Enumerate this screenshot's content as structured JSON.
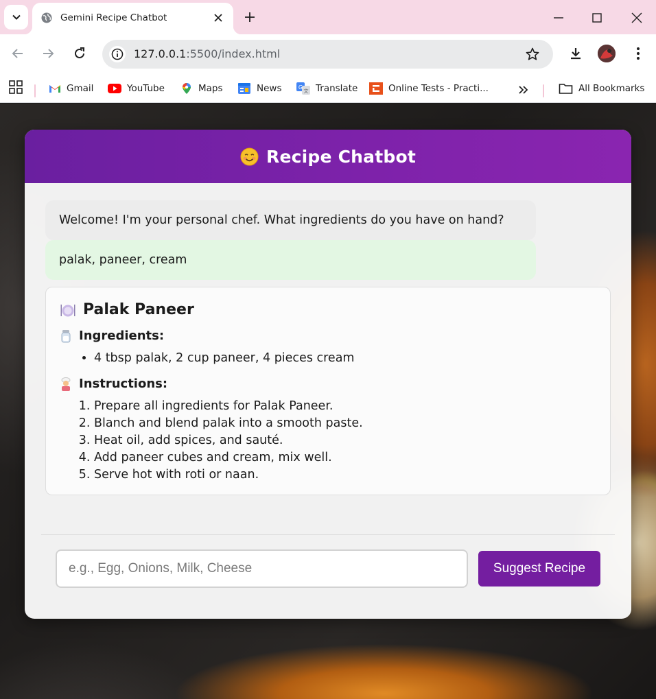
{
  "browser": {
    "tab_title": "Gemini Recipe Chatbot",
    "url_host": "127.0.0.1",
    "url_path": ":5500/index.html",
    "bookmarks": [
      {
        "label": "Gmail",
        "icon": "gmail-icon"
      },
      {
        "label": "YouTube",
        "icon": "youtube-icon"
      },
      {
        "label": "Maps",
        "icon": "maps-icon"
      },
      {
        "label": "News",
        "icon": "news-icon"
      },
      {
        "label": "Translate",
        "icon": "translate-icon"
      },
      {
        "label": "Online Tests - Practi...",
        "icon": "online-tests-icon"
      }
    ],
    "all_bookmarks": "All Bookmarks"
  },
  "app": {
    "title": "Recipe Chatbot",
    "title_emoji": "smiling-face-icon",
    "brand_color": "#7b21a8"
  },
  "chat": {
    "bot_message": "Welcome! I'm your personal chef. What ingredients do you have on hand?",
    "user_message": "palak, paneer, cream"
  },
  "recipe": {
    "name": "Palak Paneer",
    "ingredients_heading": "Ingredients:",
    "ingredients": [
      "4 tbsp palak, 2 cup paneer, 4 pieces cream"
    ],
    "instructions_heading": "Instructions:",
    "instructions": [
      "Prepare all ingredients for Palak Paneer.",
      "Blanch and blend palak into a smooth paste.",
      "Heat oil, add spices, and sauté.",
      "Add paneer cubes and cream, mix well.",
      "Serve hot with roti or naan."
    ]
  },
  "input": {
    "placeholder": "e.g., Egg, Onions, Milk, Cheese",
    "value": ""
  },
  "submit_label": "Suggest Recipe"
}
